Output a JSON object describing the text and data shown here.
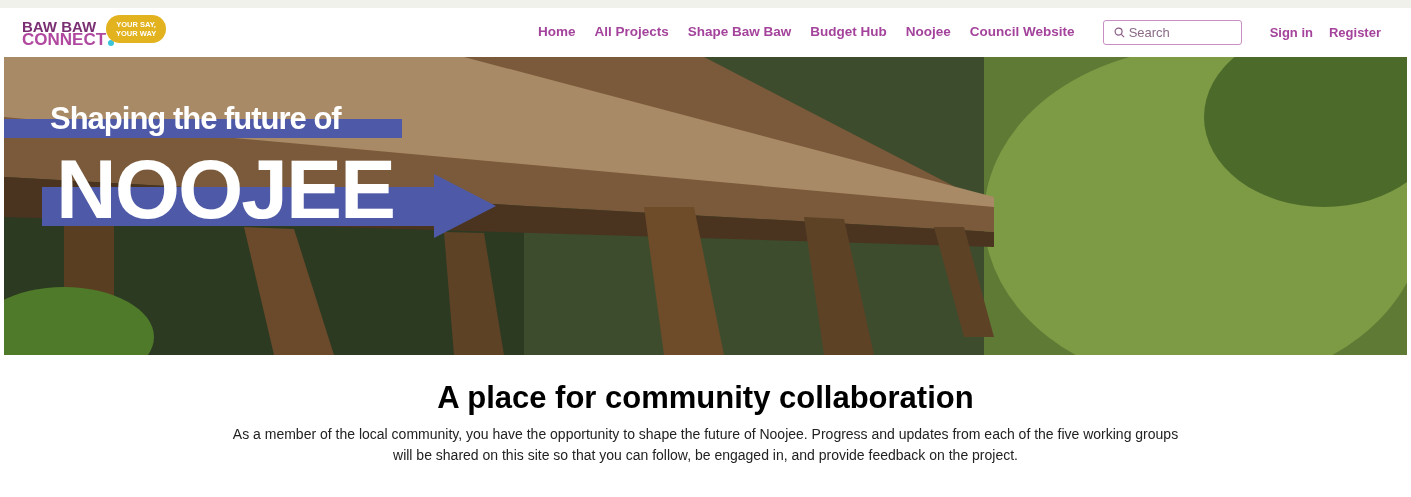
{
  "logo": {
    "line_1": "BAW BAW",
    "line_2": "CONNECT",
    "bubble": "YOUR SAY, YOUR WAY"
  },
  "nav": {
    "links": [
      "Home",
      "All Projects",
      "Shape Baw Baw",
      "Budget Hub",
      "Noojee",
      "Council Website"
    ],
    "search": {
      "placeholder": "Search"
    },
    "account_links": [
      "Sign in",
      "Register"
    ]
  },
  "hero": {
    "kind": "picture",
    "tagline": "Shaping the future of",
    "title": "NOOJEE"
  },
  "intro": {
    "heading": "A place for community collaboration",
    "text": "As a member of the local community, you have the opportunity to shape the future of Noojee. Progress and updates from each of the five working groups will be shared on this site so that you can follow, be engaged in, and provide feedback on the project."
  }
}
